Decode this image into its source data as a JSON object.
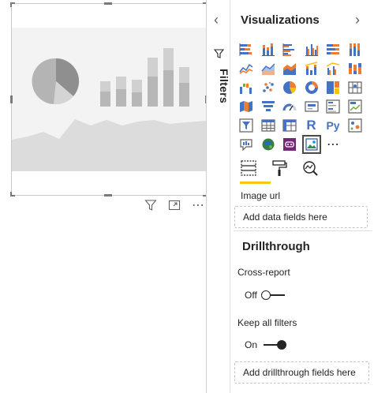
{
  "filters_pane": {
    "collapse_glyph": "‹",
    "label": "Filters"
  },
  "visual_toolbar": {
    "icons": [
      "filter-icon",
      "focus-mode-icon",
      "more-options-icon"
    ],
    "more_glyph": "⋯"
  },
  "visualizations": {
    "title": "Visualizations",
    "expand_glyph": "›",
    "icon_text": {
      "r_visual": "R",
      "python_visual": "Py",
      "more": "⋯"
    },
    "gallery_icons": [
      "stacked-bar-chart-icon",
      "stacked-column-chart-icon",
      "clustered-bar-chart-icon",
      "clustered-column-chart-icon",
      "100-stacked-bar-chart-icon",
      "100-stacked-column-chart-icon",
      "line-chart-icon",
      "area-chart-icon",
      "stacked-area-chart-icon",
      "line-and-stacked-column-chart-icon",
      "line-and-clustered-column-chart-icon",
      "ribbon-chart-icon",
      "waterfall-chart-icon",
      "scatter-chart-icon",
      "pie-chart-icon",
      "donut-chart-icon",
      "treemap-icon",
      "map-icon",
      "filled-map-icon",
      "funnel-icon",
      "gauge-icon",
      "card-icon",
      "multi-row-card-icon",
      "kpi-icon",
      "slicer-icon",
      "table-icon",
      "matrix-icon",
      "r-script-visual-icon",
      "python-visual-icon",
      "key-influencers-icon",
      "qa-visual-icon",
      "arcgis-map-icon",
      "power-apps-icon",
      "image-url-visual-icon",
      "more-visuals-icon"
    ],
    "selected_icon": "image-url-visual-icon",
    "tabs": [
      "fields-tab",
      "format-tab",
      "analytics-tab"
    ],
    "active_tab": "fields-tab",
    "field_well_label": "Image url",
    "field_well_placeholder": "Add data fields here",
    "drillthrough": {
      "title": "Drillthrough",
      "cross_report_label": "Cross-report",
      "cross_report_state": "Off",
      "keep_filters_label": "Keep all filters",
      "keep_filters_state": "On",
      "drop_placeholder": "Add drillthrough fields here"
    }
  },
  "colors": {
    "accent_tab": "#f2c811",
    "chart_blue": "#4472c4",
    "chart_orange": "#ed7d31",
    "chart_gray": "#a5a5a5",
    "chart_yellow": "#ffc000",
    "chart_teal": "#118dff",
    "text": "#252423"
  }
}
